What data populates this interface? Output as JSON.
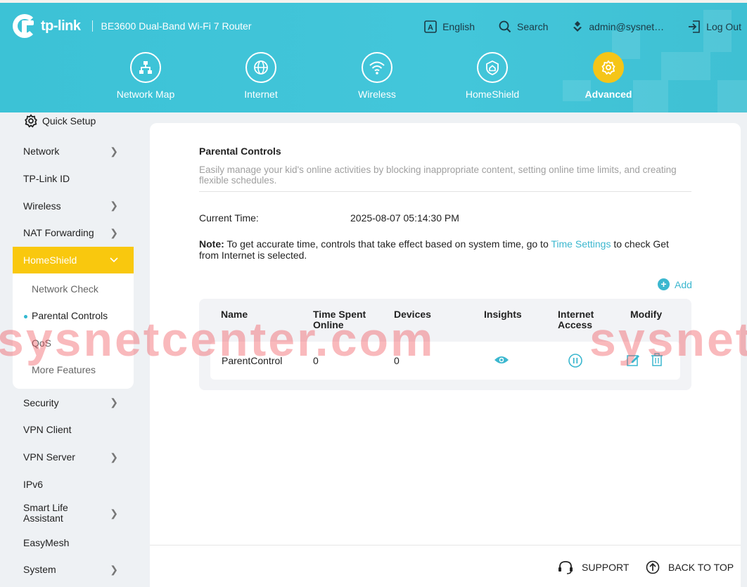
{
  "header": {
    "brand": "tp-link",
    "model": "BE3600 Dual-Band Wi-Fi 7 Router",
    "language": "English",
    "search": "Search",
    "user": "admin@sysnet…",
    "logout": "Log Out"
  },
  "nav": [
    {
      "label": "Network Map",
      "icon": "network-map-icon"
    },
    {
      "label": "Internet",
      "icon": "globe-icon"
    },
    {
      "label": "Wireless",
      "icon": "wifi-icon"
    },
    {
      "label": "HomeShield",
      "icon": "homeshield-icon"
    },
    {
      "label": "Advanced",
      "icon": "gear-icon",
      "active": true
    }
  ],
  "sidebar": {
    "quick_setup": "Quick Setup",
    "items": [
      {
        "label": "Network",
        "chevron": true
      },
      {
        "label": "TP-Link ID",
        "chevron": false
      },
      {
        "label": "Wireless",
        "chevron": true
      },
      {
        "label": "NAT Forwarding",
        "chevron": true
      },
      {
        "label": "HomeShield",
        "chevron": true,
        "expanded": true
      }
    ],
    "sub_items": [
      "Network Check",
      "Parental Controls",
      "QoS",
      "More Features"
    ],
    "items_after": [
      {
        "label": "Security",
        "chevron": true
      },
      {
        "label": "VPN Client",
        "chevron": false
      },
      {
        "label": "VPN Server",
        "chevron": true
      },
      {
        "label": "IPv6",
        "chevron": false
      },
      {
        "label": "Smart Life Assistant",
        "chevron": true
      },
      {
        "label": "EasyMesh",
        "chevron": false
      },
      {
        "label": "System",
        "chevron": true
      }
    ]
  },
  "main": {
    "title": "Parental Controls",
    "description": "Easily manage your kid's online activities by blocking inappropriate content, setting online time limits, and creating flexible schedules.",
    "current_time_label": "Current Time:",
    "current_time_value": "2025-08-07 05:14:30 PM",
    "note_label": "Note:",
    "note_text_1": " To get accurate time, controls that take effect based on system time, go to ",
    "note_link": "Time Settings",
    "note_text_2": " to check Get from Internet is selected.",
    "add_label": "Add",
    "table": {
      "headers": [
        "Name",
        "Time Spent Online",
        "Devices",
        "Insights",
        "Internet Access",
        "Modify"
      ],
      "rows": [
        {
          "name": "ParentControl",
          "time_spent": "0",
          "devices": "0"
        }
      ]
    }
  },
  "footer": {
    "support": "SUPPORT",
    "back_to_top": "BACK TO TOP"
  },
  "watermark": "sysnetcenter.com",
  "colors": {
    "header": "#43c6da",
    "accent": "#3bb7cf",
    "active_yellow": "#f9c80e"
  }
}
